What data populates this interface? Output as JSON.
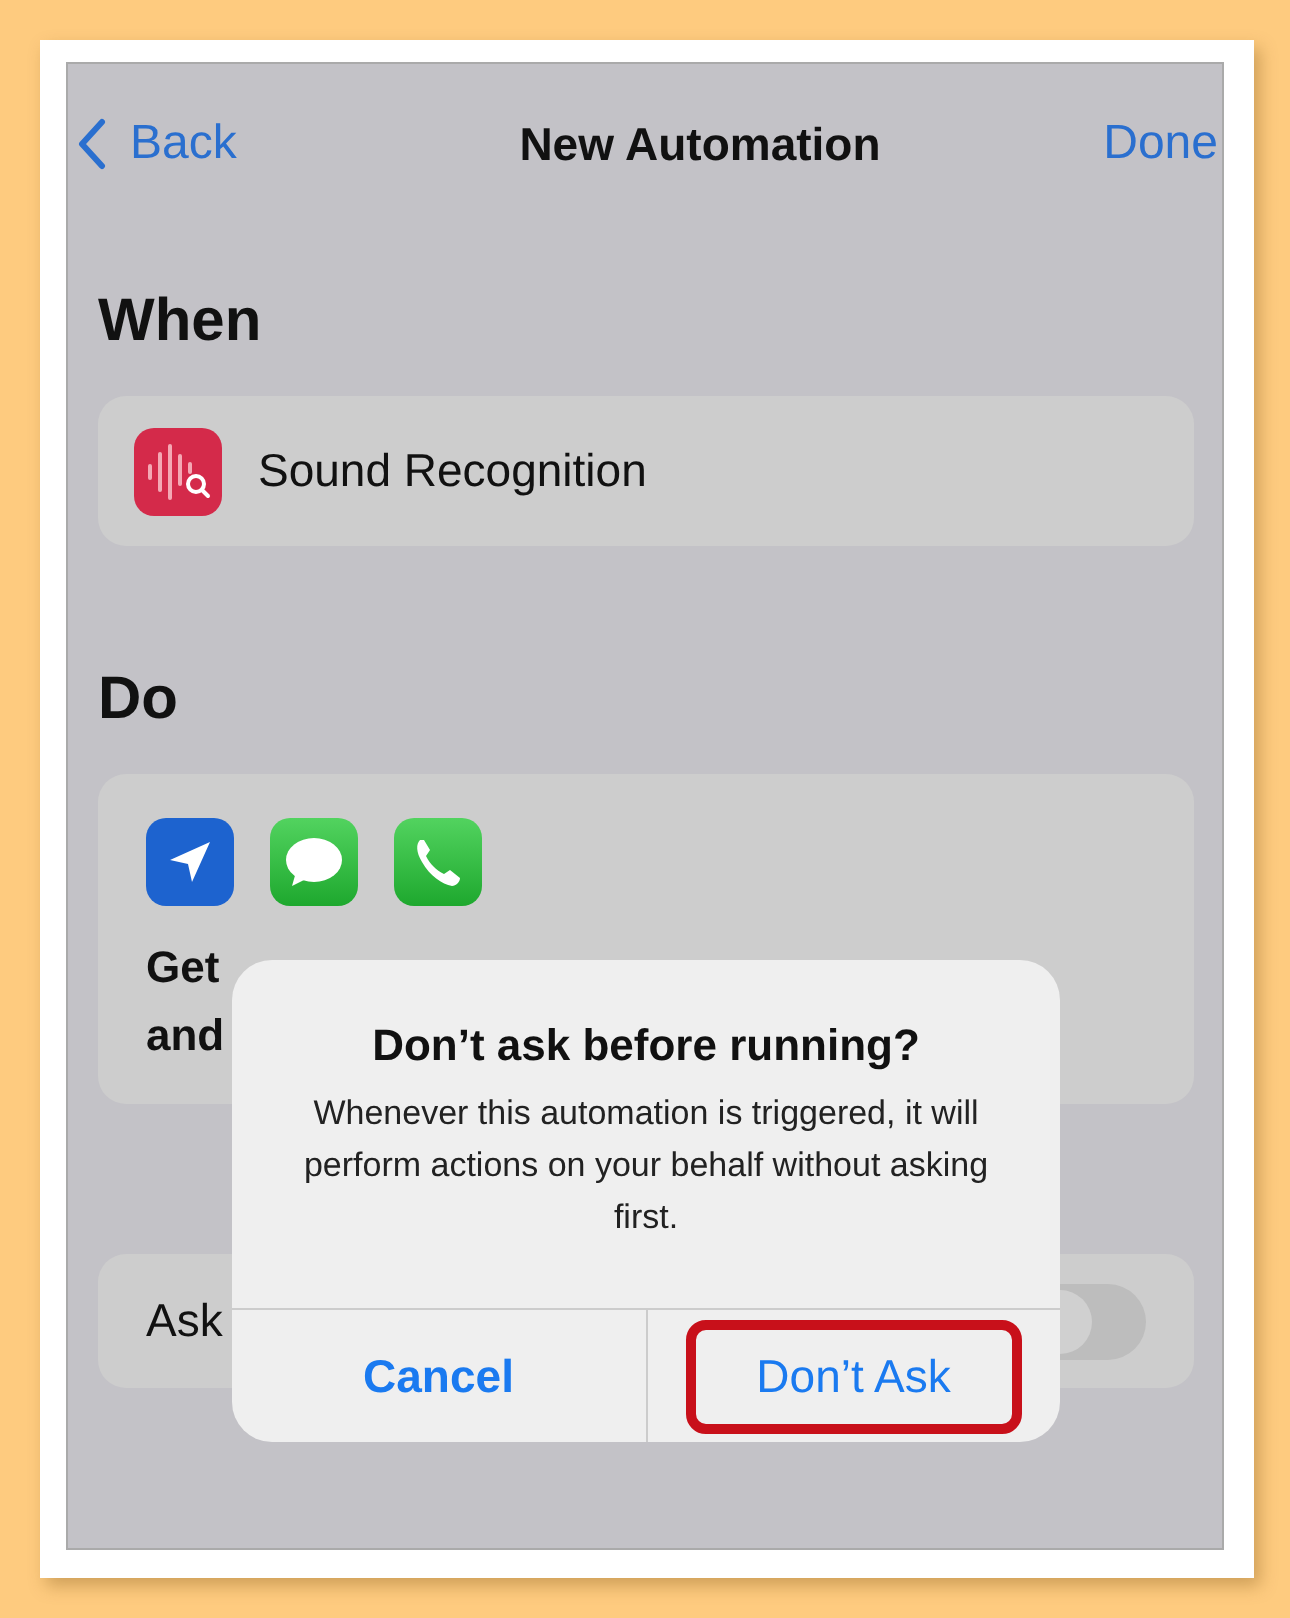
{
  "nav": {
    "back": "Back",
    "title": "New Automation",
    "done": "Done"
  },
  "when": {
    "heading": "When",
    "trigger": "Sound Recognition"
  },
  "do": {
    "heading": "Do",
    "lines": [
      "Get",
      "and"
    ]
  },
  "ask_row": {
    "label": "Ask",
    "on": false
  },
  "alert": {
    "title": "Don’t ask before running?",
    "message": "Whenever this automation is triggered, it will perform actions on your behalf without asking first.",
    "buttons": [
      {
        "label": "Cancel",
        "kind": "cancel",
        "highlighted": false
      },
      {
        "label": "Don’t Ask",
        "kind": "default",
        "highlighted": true
      }
    ]
  }
}
